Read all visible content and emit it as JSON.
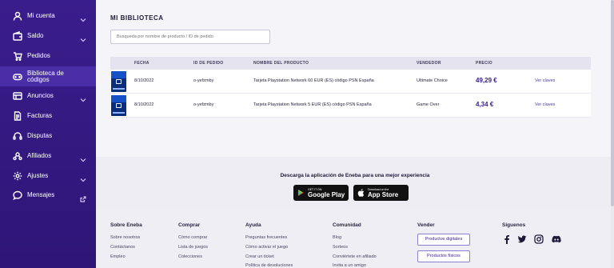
{
  "sidebar": {
    "items": [
      {
        "label": "Mi cuenta",
        "icon": "user-icon",
        "chevron": true
      },
      {
        "label": "Saldo",
        "icon": "wallet-icon",
        "chevron": true
      },
      {
        "label": "Pedidos",
        "icon": "cart-icon",
        "chevron": false
      },
      {
        "label": "Biblioteca de\ncódigos",
        "icon": "gamepad-icon",
        "chevron": false,
        "active": true
      },
      {
        "label": "Anuncios",
        "icon": "ads-icon",
        "chevron": true
      },
      {
        "label": "Facturas",
        "icon": "invoice-icon",
        "chevron": false
      },
      {
        "label": "Disputas",
        "icon": "headset-icon",
        "chevron": false
      },
      {
        "label": "Afiliados",
        "icon": "affiliate-icon",
        "chevron": true
      },
      {
        "label": "Ajustes",
        "icon": "gear-icon",
        "chevron": true
      },
      {
        "label": "Mensajes",
        "icon": "chat-icon",
        "chevron": false,
        "external": true
      }
    ]
  },
  "page": {
    "title": "MI BIBLIOTECA",
    "search_placeholder": "Busqueda por nombre de producto / ID de pedido"
  },
  "table": {
    "headers": {
      "fecha": "FECHA",
      "id": "ID DE PEDIDO",
      "producto": "NOMBRE DEL PRODUCTO",
      "vendedor": "VENDEDOR",
      "precio": "PRECIO"
    },
    "rows": [
      {
        "fecha": "8/10/2022",
        "id": "o-yefzmby",
        "producto": "Tarjeta Playstation Network 60 EUR (ES) código PSN España",
        "vendedor": "Ultimate Choice",
        "precio": "49,29 €",
        "accion": "Ver claves"
      },
      {
        "fecha": "8/10/2022",
        "id": "o-yefzmby",
        "producto": "Tarjeta Playstation Network 5 EUR (ES) código PSN España",
        "vendedor": "Game Over",
        "precio": "4,34 €",
        "accion": "Ver claves"
      }
    ]
  },
  "app": {
    "title": "Descarga la aplicación de Eneba para una mejor experiencia",
    "google_small": "GET IT ON",
    "google_big": "Google Play",
    "apple_small": "Download on the",
    "apple_big": "App Store"
  },
  "footer": {
    "sobre": {
      "title": "Sobre Eneba",
      "links": [
        "Sobre nosotros",
        "Contáctanos",
        "Empleo"
      ]
    },
    "comprar": {
      "title": "Comprar",
      "links": [
        "Cómo comprar",
        "Lista de juegos",
        "Colecciones"
      ]
    },
    "ayuda": {
      "title": "Ayuda",
      "links": [
        "Preguntas frecuentes",
        "Cómo activar el juego",
        "Crear un ticket",
        "Política de devoluciones"
      ]
    },
    "comunidad": {
      "title": "Comunidad",
      "links": [
        "Blog",
        "Sorteos",
        "Conviértete en afiliado",
        "Invita a un amigo"
      ]
    },
    "vender": {
      "title": "Vender",
      "buttons": [
        "Productos digitales",
        "Productos físicos"
      ]
    },
    "siguenos": {
      "title": "Síguenos",
      "icons": [
        "facebook-icon",
        "twitter-icon",
        "instagram-icon",
        "discord-icon"
      ]
    }
  }
}
